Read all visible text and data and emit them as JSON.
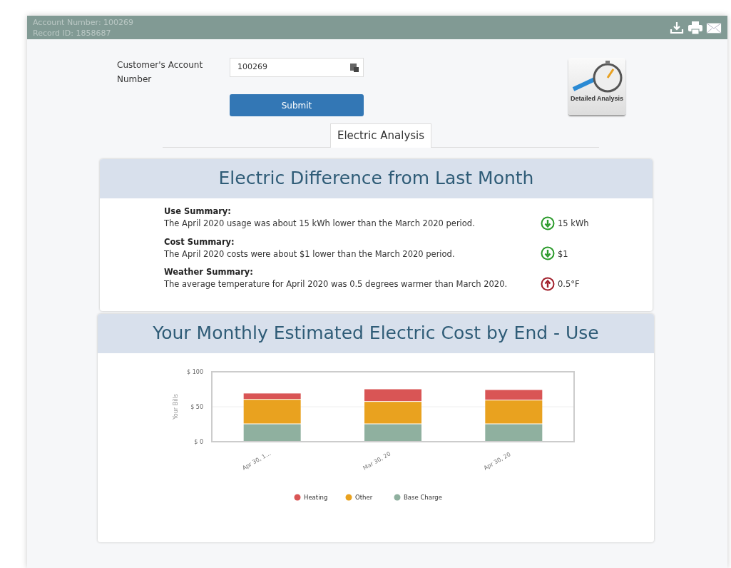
{
  "header": {
    "lines": [
      "Account Number: 100269",
      "Record ID: 1858687"
    ]
  },
  "form": {
    "label": "Customer's Account Number",
    "value": "100269",
    "submit": "Submit",
    "detailed_analysis": "Detailed Analysis"
  },
  "tabs": [
    {
      "label": "Electric Analysis",
      "selected": true
    }
  ],
  "difference": {
    "title": "Electric Difference from Last Month",
    "items": [
      {
        "heading": "Use Summary:",
        "text": "The April 2020 usage was about 15 kWh lower than the March 2020 period.",
        "kind": "down",
        "value": "15 kWh"
      },
      {
        "heading": "Cost Summary:",
        "text": "The April 2020 costs were about $1 lower than the March 2020 period.",
        "kind": "down",
        "value": "$1"
      },
      {
        "heading": "Weather Summary:",
        "text": "The average temperature for April 2020 was 0.5 degrees warmer than March 2020.",
        "kind": "up",
        "value": "0.5°F"
      }
    ]
  },
  "cost": {
    "title": "Your Monthly Estimated Electric Cost by End - Use",
    "chart_data": {
      "type": "bar",
      "stacked": true,
      "legend": "bottom",
      "ylabel": "Your Bills",
      "categories": [
        "Apr 30, 1…",
        "Mar 30, 20",
        "Apr 30, 20"
      ],
      "ylim": [
        0,
        100
      ],
      "yticks": [
        {
          "value": 0,
          "label": "$ 0"
        },
        {
          "value": 50,
          "label": "$ 50"
        },
        {
          "value": 100,
          "label": "$ 100"
        }
      ],
      "series": [
        {
          "name": "Base Charge",
          "color": "#8fb09f",
          "values": [
            25,
            25,
            25
          ]
        },
        {
          "name": "Other",
          "color": "#e9a21f",
          "values": [
            35,
            32,
            34
          ]
        },
        {
          "name": "Heating",
          "color": "#d95555",
          "values": [
            9,
            18,
            15
          ]
        }
      ]
    }
  }
}
